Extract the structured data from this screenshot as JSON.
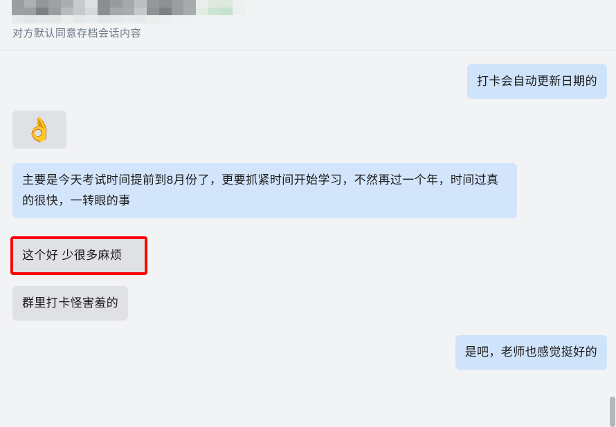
{
  "header": {
    "redacted_name_placeholder": "",
    "archive_notice": "对方默认同意存档会话内容"
  },
  "colors": {
    "page_background": "#f2f3f5",
    "incoming_bubble": "#e0e1e4",
    "outgoing_bubble": "#cfe3fb",
    "wide_bubble": "#d3e5fb",
    "highlight_border": "#fe0000",
    "notice_text": "#6b7785",
    "message_text": "#1a1a1a",
    "scrollbar_thumb": "#b4b6bb",
    "divider": "#e2e3e5"
  },
  "messages": [
    {
      "id": "m1",
      "side": "right",
      "type": "text",
      "text": "打卡会自动更新日期的",
      "highlighted": false
    },
    {
      "id": "m2",
      "side": "left",
      "type": "sticker",
      "text": "👌",
      "icon_name": "ok-hand-emoji",
      "highlighted": false
    },
    {
      "id": "m3",
      "side": "left",
      "type": "text",
      "text": "主要是今天考试时间提前到8月份了，更要抓紧时间开始学习，不然再过一个年，时间过真的很快，一转眼的事",
      "highlighted": false
    },
    {
      "id": "m4",
      "side": "left",
      "type": "text",
      "text": "这个好 少很多麻烦",
      "highlighted": true
    },
    {
      "id": "m5",
      "side": "left",
      "type": "text",
      "text": "群里打卡怪害羞的",
      "highlighted": false
    },
    {
      "id": "m6",
      "side": "right",
      "type": "text",
      "text": "是吧，老师也感觉挺好的",
      "highlighted": false
    }
  ],
  "mosaic": {
    "rows": [
      [
        "#9c9d9f",
        "#aeafb1",
        "#93979c",
        "#9fa1a4",
        "#aaacaf",
        "#c9cccf",
        "#dfe0e2",
        "#8b8d91",
        "#989a9e",
        "#a5a7ab",
        "#bcbec1",
        "#95979b",
        "#8e9093",
        "#9b9da1",
        "#a7a9ad",
        "#e9eeea",
        "#dfe9e0",
        "#dce9dd",
        "#eef2ef"
      ],
      [
        "#9e9fa1",
        "#9d9ea0",
        "#7d7f82",
        "#9b9d9f",
        "#b9bbbe",
        "#c7c9cc",
        "#d6d8da",
        "#8d8f93",
        "#a6a8ab",
        "#a9abaf",
        "#c6c8ca",
        "#8f9195",
        "#7d7f83",
        "#9a9ca0",
        "#a8aaae",
        "#e2ece4",
        "#cde4d3",
        "#c7e1cf",
        "#eaf0ec"
      ],
      [
        "#e8e9eb",
        "#e3e4e6",
        "#e6e7e9",
        "#e5e6e8",
        "#eceded",
        "#e6e7e9",
        "#e9eaec",
        "#e5e6e8",
        "#e7e8ea",
        "#e9eaec",
        "#e8e9eb",
        "#eceded",
        "#eeeff0",
        "#f0f1f2",
        "#f0f1f2",
        "#f1f2f3",
        "#f1f2f3",
        "#f1f2f3",
        "#f2f3f5"
      ]
    ]
  },
  "scrollbar": {
    "present": true
  }
}
